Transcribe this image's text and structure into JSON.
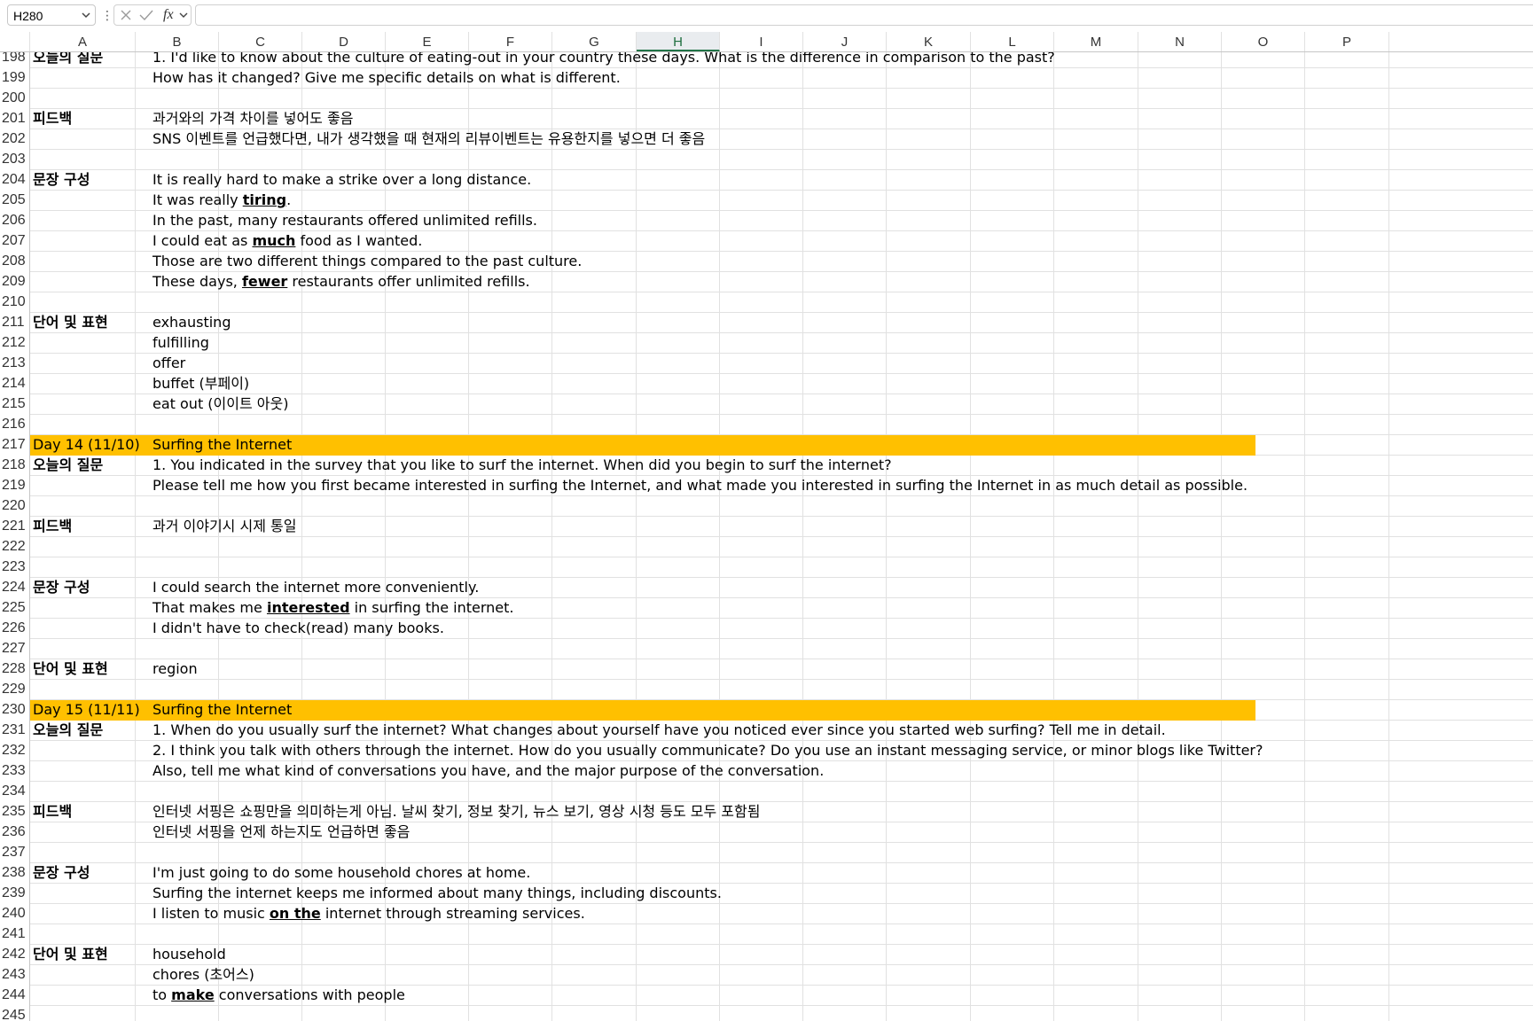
{
  "formula_bar": {
    "name_box": "H280",
    "fx_label": "fx",
    "formula_value": ""
  },
  "columns": [
    "A",
    "B",
    "C",
    "D",
    "E",
    "F",
    "G",
    "H",
    "I",
    "J",
    "K",
    "L",
    "M",
    "N",
    "O",
    "P"
  ],
  "active_column": "H",
  "highlight_color": "#ffc000",
  "rows": [
    {
      "num": "198",
      "a": "오늘의 질문",
      "a_bold": true,
      "b": "1. I'd like to know about the culture of eating-out in your country these days. What is the difference in comparison to the past?"
    },
    {
      "num": "199",
      "a": "",
      "b": "How has it changed? Give me specific details on what is different."
    },
    {
      "num": "200",
      "a": "",
      "b": ""
    },
    {
      "num": "201",
      "a": "피드백",
      "a_bold": true,
      "b": "과거와의 가격 차이를 넣어도 좋음"
    },
    {
      "num": "202",
      "a": "",
      "b": "SNS 이벤트를 언급했다면, 내가 생각했을 때 현재의 리뷰이벤트는 유용한지를 넣으면 더 좋음"
    },
    {
      "num": "203",
      "a": "",
      "b": ""
    },
    {
      "num": "204",
      "a": "문장 구성",
      "a_bold": true,
      "b": "It is really hard to make a strike over a long distance."
    },
    {
      "num": "205",
      "a": "",
      "b_parts": [
        {
          "t": "It was really "
        },
        {
          "t": "tiring",
          "u": true
        },
        {
          "t": "."
        }
      ]
    },
    {
      "num": "206",
      "a": "",
      "b": "In the past, many restaurants offered unlimited refills."
    },
    {
      "num": "207",
      "a": "",
      "b_parts": [
        {
          "t": "I could eat as "
        },
        {
          "t": "much",
          "u": true
        },
        {
          "t": " food as I wanted."
        }
      ]
    },
    {
      "num": "208",
      "a": "",
      "b": "Those are two different things compared to the past culture."
    },
    {
      "num": "209",
      "a": "",
      "b_parts": [
        {
          "t": "These days, "
        },
        {
          "t": "fewer",
          "u": true
        },
        {
          "t": " restaurants offer unlimited refills."
        }
      ]
    },
    {
      "num": "210",
      "a": "",
      "b": ""
    },
    {
      "num": "211",
      "a": "단어 및 표현",
      "a_bold": true,
      "b": "exhausting"
    },
    {
      "num": "212",
      "a": "",
      "b": "fulfilling"
    },
    {
      "num": "213",
      "a": "",
      "b": "offer"
    },
    {
      "num": "214",
      "a": "",
      "b": "buffet (부페이)"
    },
    {
      "num": "215",
      "a": "",
      "b": "eat out (이이트 아웃)"
    },
    {
      "num": "216",
      "a": "",
      "b": ""
    },
    {
      "num": "217",
      "a": "Day 14 (11/10)",
      "hl": true,
      "b": "Surfing the Internet"
    },
    {
      "num": "218",
      "a": "오늘의 질문",
      "a_bold": true,
      "b": "1. You indicated in the survey that you like to surf the internet. When did you begin to surf the internet?"
    },
    {
      "num": "219",
      "a": "",
      "b": "Please tell me how you first became interested in surfing the Internet, and what made you interested in surfing the Internet in as much detail as possible."
    },
    {
      "num": "220",
      "a": "",
      "b": ""
    },
    {
      "num": "221",
      "a": "피드백",
      "a_bold": true,
      "b": "과거 이야기시 시제 통일"
    },
    {
      "num": "222",
      "a": "",
      "b": ""
    },
    {
      "num": "223",
      "a": "",
      "b": ""
    },
    {
      "num": "224",
      "a": "문장 구성",
      "a_bold": true,
      "b": "I could search the internet more conveniently."
    },
    {
      "num": "225",
      "a": "",
      "b_parts": [
        {
          "t": "That makes me "
        },
        {
          "t": "interested",
          "u": true
        },
        {
          "t": " in surfing the internet."
        }
      ]
    },
    {
      "num": "226",
      "a": "",
      "b": "I didn't have to check(read) many books."
    },
    {
      "num": "227",
      "a": "",
      "b": ""
    },
    {
      "num": "228",
      "a": "단어 및 표현",
      "a_bold": true,
      "b": "region"
    },
    {
      "num": "229",
      "a": "",
      "b": ""
    },
    {
      "num": "230",
      "a": "Day 15 (11/11)",
      "hl": true,
      "b": "Surfing the Internet"
    },
    {
      "num": "231",
      "a": "오늘의 질문",
      "a_bold": true,
      "b": "1. When do you usually surf the internet? What changes about yourself have you noticed ever since you started web surfing? Tell me in detail."
    },
    {
      "num": "232",
      "a": "",
      "b": "2. I think you talk with others through the internet. How do you usually communicate? Do you use an instant messaging service, or minor blogs like Twitter?"
    },
    {
      "num": "233",
      "a": "",
      "b": "Also, tell me what kind of conversations you have, and the major purpose of the conversation."
    },
    {
      "num": "234",
      "a": "",
      "b": ""
    },
    {
      "num": "235",
      "a": "피드백",
      "a_bold": true,
      "b": "인터넷 서핑은 쇼핑만을 의미하는게 아님. 날씨 찾기, 정보 찾기, 뉴스 보기, 영상 시청 등도 모두 포함됨"
    },
    {
      "num": "236",
      "a": "",
      "b": "인터넷 서핑을 언제 하는지도 언급하면 좋음"
    },
    {
      "num": "237",
      "a": "",
      "b": ""
    },
    {
      "num": "238",
      "a": "문장 구성",
      "a_bold": true,
      "b": "I'm just going to do some household chores at home."
    },
    {
      "num": "239",
      "a": "",
      "b": "Surfing the internet keeps me informed about many things, including discounts."
    },
    {
      "num": "240",
      "a": "",
      "b_parts": [
        {
          "t": "I listen to music "
        },
        {
          "t": "on the",
          "u": true
        },
        {
          "t": " internet through streaming services."
        }
      ]
    },
    {
      "num": "241",
      "a": "",
      "b": ""
    },
    {
      "num": "242",
      "a": "단어 및 표현",
      "a_bold": true,
      "b": "household"
    },
    {
      "num": "243",
      "a": "",
      "b": "chores (초어스)"
    },
    {
      "num": "244",
      "a": "",
      "b_parts": [
        {
          "t": "to "
        },
        {
          "t": "make",
          "u": true
        },
        {
          "t": " conversations with people"
        }
      ]
    },
    {
      "num": "245",
      "a": "",
      "b": ""
    }
  ]
}
